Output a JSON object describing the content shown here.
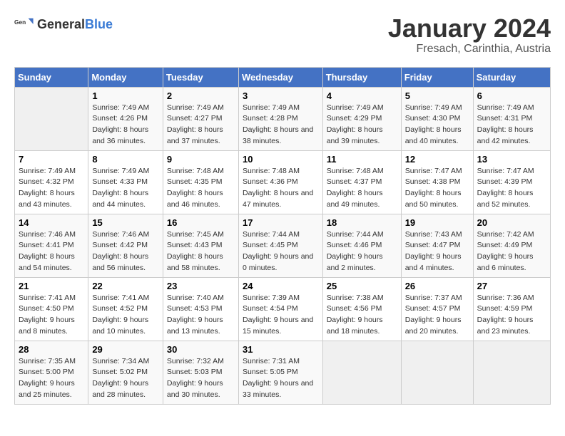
{
  "header": {
    "logo_general": "General",
    "logo_blue": "Blue",
    "title": "January 2024",
    "subtitle": "Fresach, Carinthia, Austria"
  },
  "days_of_week": [
    "Sunday",
    "Monday",
    "Tuesday",
    "Wednesday",
    "Thursday",
    "Friday",
    "Saturday"
  ],
  "weeks": [
    [
      {
        "day": "",
        "sunrise": "",
        "sunset": "",
        "daylight": "",
        "empty": true
      },
      {
        "day": "1",
        "sunrise": "Sunrise: 7:49 AM",
        "sunset": "Sunset: 4:26 PM",
        "daylight": "Daylight: 8 hours and 36 minutes."
      },
      {
        "day": "2",
        "sunrise": "Sunrise: 7:49 AM",
        "sunset": "Sunset: 4:27 PM",
        "daylight": "Daylight: 8 hours and 37 minutes."
      },
      {
        "day": "3",
        "sunrise": "Sunrise: 7:49 AM",
        "sunset": "Sunset: 4:28 PM",
        "daylight": "Daylight: 8 hours and 38 minutes."
      },
      {
        "day": "4",
        "sunrise": "Sunrise: 7:49 AM",
        "sunset": "Sunset: 4:29 PM",
        "daylight": "Daylight: 8 hours and 39 minutes."
      },
      {
        "day": "5",
        "sunrise": "Sunrise: 7:49 AM",
        "sunset": "Sunset: 4:30 PM",
        "daylight": "Daylight: 8 hours and 40 minutes."
      },
      {
        "day": "6",
        "sunrise": "Sunrise: 7:49 AM",
        "sunset": "Sunset: 4:31 PM",
        "daylight": "Daylight: 8 hours and 42 minutes."
      }
    ],
    [
      {
        "day": "7",
        "sunrise": "Sunrise: 7:49 AM",
        "sunset": "Sunset: 4:32 PM",
        "daylight": "Daylight: 8 hours and 43 minutes."
      },
      {
        "day": "8",
        "sunrise": "Sunrise: 7:49 AM",
        "sunset": "Sunset: 4:33 PM",
        "daylight": "Daylight: 8 hours and 44 minutes."
      },
      {
        "day": "9",
        "sunrise": "Sunrise: 7:48 AM",
        "sunset": "Sunset: 4:35 PM",
        "daylight": "Daylight: 8 hours and 46 minutes."
      },
      {
        "day": "10",
        "sunrise": "Sunrise: 7:48 AM",
        "sunset": "Sunset: 4:36 PM",
        "daylight": "Daylight: 8 hours and 47 minutes."
      },
      {
        "day": "11",
        "sunrise": "Sunrise: 7:48 AM",
        "sunset": "Sunset: 4:37 PM",
        "daylight": "Daylight: 8 hours and 49 minutes."
      },
      {
        "day": "12",
        "sunrise": "Sunrise: 7:47 AM",
        "sunset": "Sunset: 4:38 PM",
        "daylight": "Daylight: 8 hours and 50 minutes."
      },
      {
        "day": "13",
        "sunrise": "Sunrise: 7:47 AM",
        "sunset": "Sunset: 4:39 PM",
        "daylight": "Daylight: 8 hours and 52 minutes."
      }
    ],
    [
      {
        "day": "14",
        "sunrise": "Sunrise: 7:46 AM",
        "sunset": "Sunset: 4:41 PM",
        "daylight": "Daylight: 8 hours and 54 minutes."
      },
      {
        "day": "15",
        "sunrise": "Sunrise: 7:46 AM",
        "sunset": "Sunset: 4:42 PM",
        "daylight": "Daylight: 8 hours and 56 minutes."
      },
      {
        "day": "16",
        "sunrise": "Sunrise: 7:45 AM",
        "sunset": "Sunset: 4:43 PM",
        "daylight": "Daylight: 8 hours and 58 minutes."
      },
      {
        "day": "17",
        "sunrise": "Sunrise: 7:44 AM",
        "sunset": "Sunset: 4:45 PM",
        "daylight": "Daylight: 9 hours and 0 minutes."
      },
      {
        "day": "18",
        "sunrise": "Sunrise: 7:44 AM",
        "sunset": "Sunset: 4:46 PM",
        "daylight": "Daylight: 9 hours and 2 minutes."
      },
      {
        "day": "19",
        "sunrise": "Sunrise: 7:43 AM",
        "sunset": "Sunset: 4:47 PM",
        "daylight": "Daylight: 9 hours and 4 minutes."
      },
      {
        "day": "20",
        "sunrise": "Sunrise: 7:42 AM",
        "sunset": "Sunset: 4:49 PM",
        "daylight": "Daylight: 9 hours and 6 minutes."
      }
    ],
    [
      {
        "day": "21",
        "sunrise": "Sunrise: 7:41 AM",
        "sunset": "Sunset: 4:50 PM",
        "daylight": "Daylight: 9 hours and 8 minutes."
      },
      {
        "day": "22",
        "sunrise": "Sunrise: 7:41 AM",
        "sunset": "Sunset: 4:52 PM",
        "daylight": "Daylight: 9 hours and 10 minutes."
      },
      {
        "day": "23",
        "sunrise": "Sunrise: 7:40 AM",
        "sunset": "Sunset: 4:53 PM",
        "daylight": "Daylight: 9 hours and 13 minutes."
      },
      {
        "day": "24",
        "sunrise": "Sunrise: 7:39 AM",
        "sunset": "Sunset: 4:54 PM",
        "daylight": "Daylight: 9 hours and 15 minutes."
      },
      {
        "day": "25",
        "sunrise": "Sunrise: 7:38 AM",
        "sunset": "Sunset: 4:56 PM",
        "daylight": "Daylight: 9 hours and 18 minutes."
      },
      {
        "day": "26",
        "sunrise": "Sunrise: 7:37 AM",
        "sunset": "Sunset: 4:57 PM",
        "daylight": "Daylight: 9 hours and 20 minutes."
      },
      {
        "day": "27",
        "sunrise": "Sunrise: 7:36 AM",
        "sunset": "Sunset: 4:59 PM",
        "daylight": "Daylight: 9 hours and 23 minutes."
      }
    ],
    [
      {
        "day": "28",
        "sunrise": "Sunrise: 7:35 AM",
        "sunset": "Sunset: 5:00 PM",
        "daylight": "Daylight: 9 hours and 25 minutes."
      },
      {
        "day": "29",
        "sunrise": "Sunrise: 7:34 AM",
        "sunset": "Sunset: 5:02 PM",
        "daylight": "Daylight: 9 hours and 28 minutes."
      },
      {
        "day": "30",
        "sunrise": "Sunrise: 7:32 AM",
        "sunset": "Sunset: 5:03 PM",
        "daylight": "Daylight: 9 hours and 30 minutes."
      },
      {
        "day": "31",
        "sunrise": "Sunrise: 7:31 AM",
        "sunset": "Sunset: 5:05 PM",
        "daylight": "Daylight: 9 hours and 33 minutes."
      },
      {
        "day": "",
        "sunrise": "",
        "sunset": "",
        "daylight": "",
        "empty": true
      },
      {
        "day": "",
        "sunrise": "",
        "sunset": "",
        "daylight": "",
        "empty": true
      },
      {
        "day": "",
        "sunrise": "",
        "sunset": "",
        "daylight": "",
        "empty": true
      }
    ]
  ]
}
